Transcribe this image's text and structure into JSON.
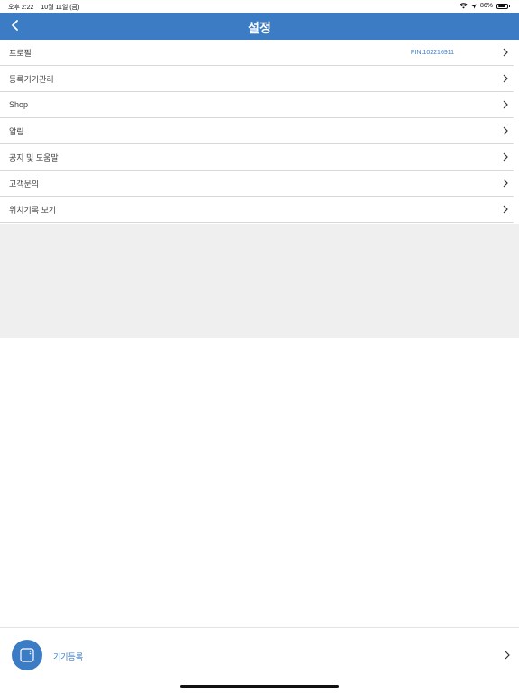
{
  "status_bar": {
    "time": "오후 2:22",
    "date": "10월 11일 (금)",
    "battery": "86%",
    "battery_level": 0.86
  },
  "nav": {
    "title": "설정",
    "back_icon": "chevron-left-icon"
  },
  "menu": {
    "items": [
      {
        "label": "프로필",
        "value": "PIN:102216911"
      },
      {
        "label": "등록기기관리"
      },
      {
        "label": "Shop"
      },
      {
        "label": "알림"
      },
      {
        "label": "공지 및 도움말"
      },
      {
        "label": "고객문의"
      },
      {
        "label": "위치기록 보기"
      }
    ]
  },
  "bottom": {
    "label": "기기등록",
    "icon": "device-icon"
  },
  "colors": {
    "accent": "#3b7cc4",
    "background": "#ffffff",
    "gray_area": "#efefef"
  }
}
